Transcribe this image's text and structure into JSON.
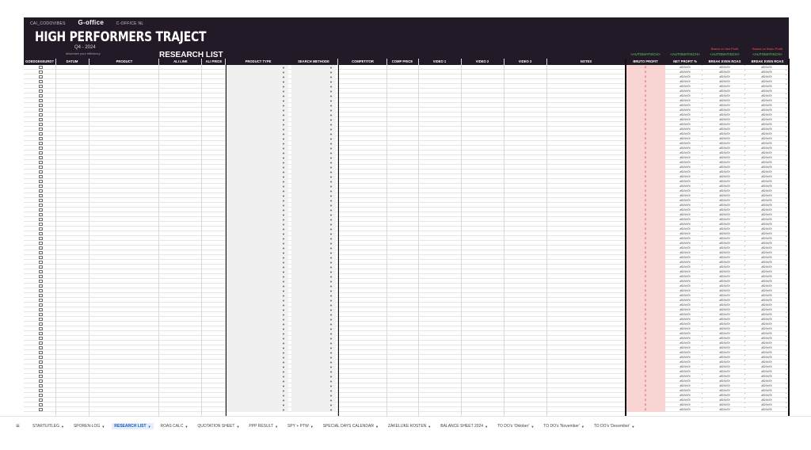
{
  "banner": {
    "top_links": [
      "CAI_CODOVIBES",
      "G-office",
      "C-OFFICE NL"
    ],
    "title": "HIGH PERFORMERS TRAJECT",
    "quarter": "Q4 - 2024",
    "tagline": "Maximize your efficiency",
    "subtitle": "RESEARCH LIST",
    "auto_label": "<AUTOMATISCH>",
    "based_net": "Based on Net Profit",
    "based_bruto": "Based on Bruto Profit"
  },
  "columns": [
    "GOEDGEKEURD?",
    "DATUM",
    "PRODUCT",
    "ALI LINK",
    "ALI PRICE",
    "PRODUCT TYPE",
    "SEARCH METHODE",
    "COMPETITOR",
    "COMP PRICE",
    "VIDEO 1",
    "VIDEO 2",
    "VIDEO 3",
    "NOTES",
    "BRUTO PROFIT",
    "NET PROFIT %",
    "BREAK EVEN ROAS",
    "BREAK EVEN ROAS"
  ],
  "cell_values": {
    "bruto": "0",
    "div_error": "#DIV/0!",
    "dropdown_arrow": "▼"
  },
  "tabs": [
    {
      "label": "STARTUITLEG",
      "active": false
    },
    {
      "label": "SPOREN-LOG",
      "active": false
    },
    {
      "label": "RESEARCH LIST",
      "active": true
    },
    {
      "label": "ROAS CALC",
      "active": false
    },
    {
      "label": "QUOTATION SHEET",
      "active": false
    },
    {
      "label": "PPP RESULT",
      "active": false
    },
    {
      "label": "SPY + PTW",
      "active": false
    },
    {
      "label": "SPECIAL DAYS CALENDAR",
      "active": false
    },
    {
      "label": "ZAKELIJKE KOSTEN",
      "active": false
    },
    {
      "label": "BALANCE SHEET 2024",
      "active": false
    },
    {
      "label": "TO DO's 'Oktober'",
      "active": false
    },
    {
      "label": "TO DO's 'November'",
      "active": false
    },
    {
      "label": "TO DO's 'December'",
      "active": false
    }
  ],
  "colors": {
    "banner_bg": "#231a27",
    "auto_green": "#5fd35f",
    "based_red": "#ff4d4d",
    "bruto_bg": "#f8d4d2",
    "active_tab": "#1a56c4"
  },
  "icons": {
    "menu": "menu-icon",
    "tab_arrow": "chevron-down-icon"
  }
}
